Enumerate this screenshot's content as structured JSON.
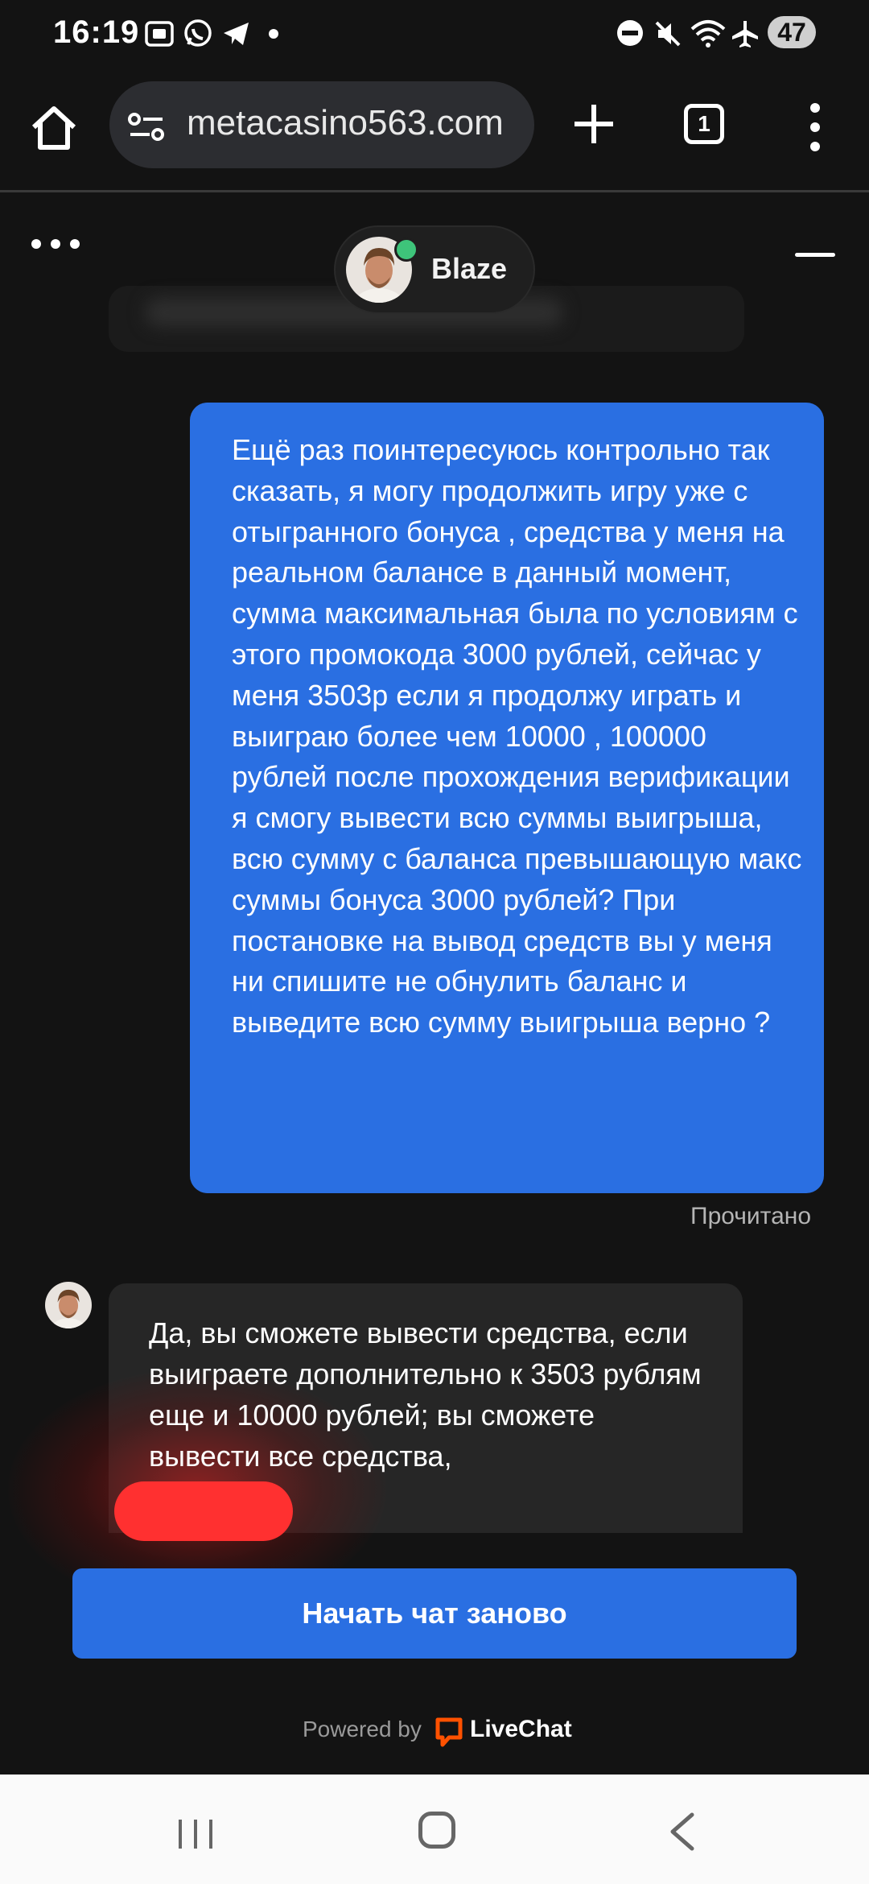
{
  "status_bar": {
    "time": "16:19",
    "battery": "47",
    "icons": [
      "screenshot-icon",
      "whatsapp-icon",
      "telegram-icon",
      "notification-dot-icon",
      "do-not-disturb-icon",
      "mute-icon",
      "wifi-icon",
      "airplane-icon",
      "battery-icon"
    ]
  },
  "browser": {
    "url": "metacasino563.com",
    "tab_count": "1",
    "icons": [
      "home-icon",
      "site-info-icon",
      "plus-icon",
      "tabs-icon",
      "more-vert-icon"
    ]
  },
  "chat": {
    "agent_name": "Blaze",
    "status_color": "#3ec47a",
    "user_message": "Ещё раз поинтересуюсь контрольно так сказать, я могу продолжить игру уже с отыгранного бонуса , средства у меня на реальном балансе в данный момент, сумма максимальная была по условиям с этого промокода 3000 рублей, сейчас у меня 3503р если я продолжу играть и выиграю более чем 10000 , 100000 рублей после прохождения верификации я смогу вывести всю суммы выигрыша, всю сумму с баланса превышающую макс суммы бонуса 3000 рублей? При постановке на вывод средств вы у меня ни спишите не обнулить баланс и выведите всю сумму выигрыша верно ?",
    "read_status": "Прочитано",
    "agent_reply": "Да, вы сможете вывести средства, если выиграете дополнительно к 3503 рублям еще и 10000 рублей; вы сможете вывести все средства,",
    "restart_label": "Начать чат заново",
    "powered_by": "Powered by",
    "brand": "LiveChat",
    "accent_color": "#2a6fe2",
    "brand_color": "#ff5100"
  }
}
